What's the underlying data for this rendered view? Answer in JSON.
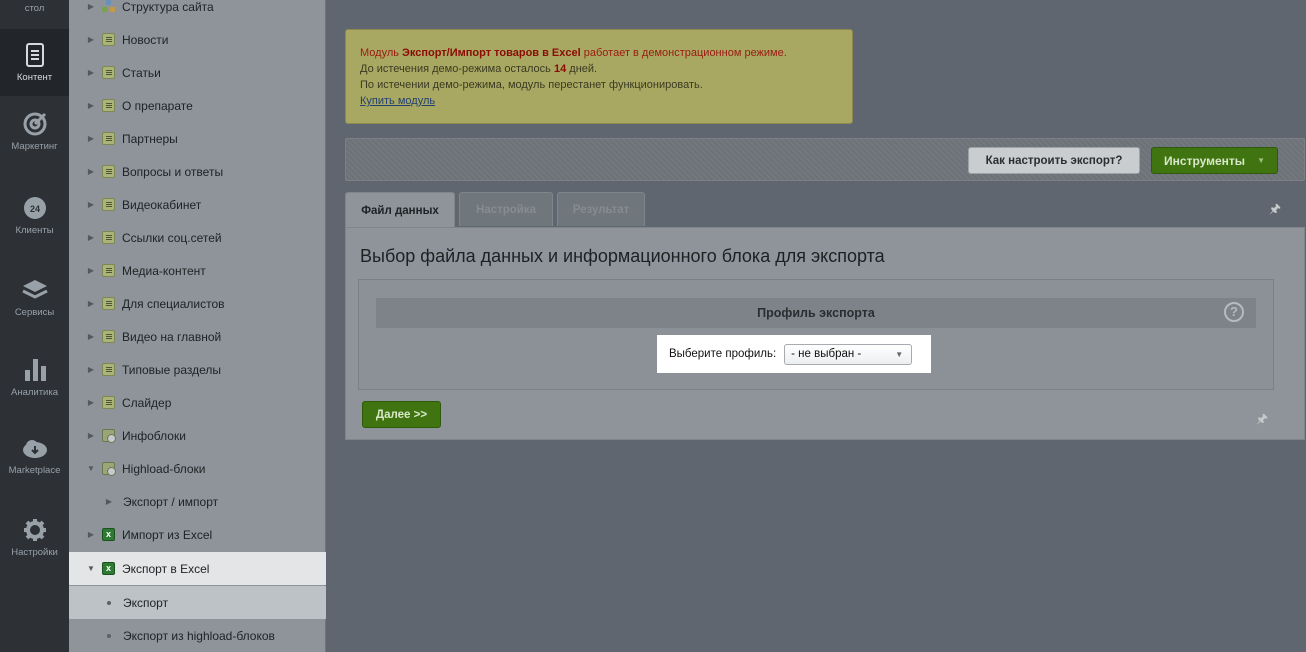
{
  "rail": {
    "items": [
      {
        "label": "стол",
        "icon": "desktop-icon"
      },
      {
        "label": "Контент",
        "icon": "document-icon",
        "active": true
      },
      {
        "label": "Маркетинг",
        "icon": "target-icon"
      },
      {
        "label": "Клиенты",
        "icon": "crm-24-icon"
      },
      {
        "label": "Сервисы",
        "icon": "layers-icon"
      },
      {
        "label": "Аналитика",
        "icon": "bar-chart-icon"
      },
      {
        "label": "Marketplace",
        "icon": "cloud-download-icon"
      },
      {
        "label": "Настройки",
        "icon": "gear-icon"
      }
    ]
  },
  "tree": {
    "items": [
      {
        "label": "Структура сайта",
        "icon": "structure-icon"
      },
      {
        "label": "Новости",
        "icon": "iblock-doc-icon"
      },
      {
        "label": "Статьи",
        "icon": "iblock-doc-icon"
      },
      {
        "label": "О препарате",
        "icon": "iblock-doc-icon"
      },
      {
        "label": "Партнеры",
        "icon": "iblock-doc-icon"
      },
      {
        "label": "Вопросы и ответы",
        "icon": "iblock-doc-icon"
      },
      {
        "label": "Видеокабинет",
        "icon": "iblock-doc-icon"
      },
      {
        "label": "Ссылки соц.сетей",
        "icon": "iblock-doc-icon"
      },
      {
        "label": "Медиа-контент",
        "icon": "iblock-doc-icon"
      },
      {
        "label": "Для специалистов",
        "icon": "iblock-doc-icon"
      },
      {
        "label": "Видео на главной",
        "icon": "iblock-doc-icon"
      },
      {
        "label": "Типовые разделы",
        "icon": "iblock-doc-icon"
      },
      {
        "label": "Слайдер",
        "icon": "iblock-doc-icon"
      },
      {
        "label": "Инфоблоки",
        "icon": "iblock-settings-icon"
      },
      {
        "label": "Highload-блоки",
        "icon": "iblock-settings-icon"
      },
      {
        "label": "Экспорт / импорт"
      },
      {
        "label": "Импорт из Excel",
        "icon": "excel-icon"
      },
      {
        "label": "Экспорт в Excel",
        "icon": "excel-icon"
      },
      {
        "label": "Экспорт"
      },
      {
        "label": "Экспорт из highload-блоков"
      }
    ]
  },
  "notice": {
    "line1_prefix": "Модуль ",
    "module_name": "Экспорт/Импорт товаров в Excel",
    "line1_suffix": " работает в демонстрационном режиме.",
    "line2_prefix": "До истечения демо-режима осталось ",
    "days": "14",
    "line2_suffix": " дней.",
    "line3": "По истечении демо-режима, модуль перестанет функционировать.",
    "buy_link": "Купить модуль"
  },
  "toolbar": {
    "help_button": "Как настроить экспорт?",
    "tools_button": "Инструменты"
  },
  "tabs": [
    {
      "label": "Файл данных",
      "active": true
    },
    {
      "label": "Настройка",
      "active": false
    },
    {
      "label": "Результат",
      "active": false
    }
  ],
  "panel": {
    "title": "Выбор файла данных и информационного блока для экспорта",
    "section_title": "Профиль экспорта",
    "help_glyph": "?",
    "profile_label": "Выберите профиль:",
    "profile_value": "- не выбран -",
    "next_button": "Далее >>"
  }
}
